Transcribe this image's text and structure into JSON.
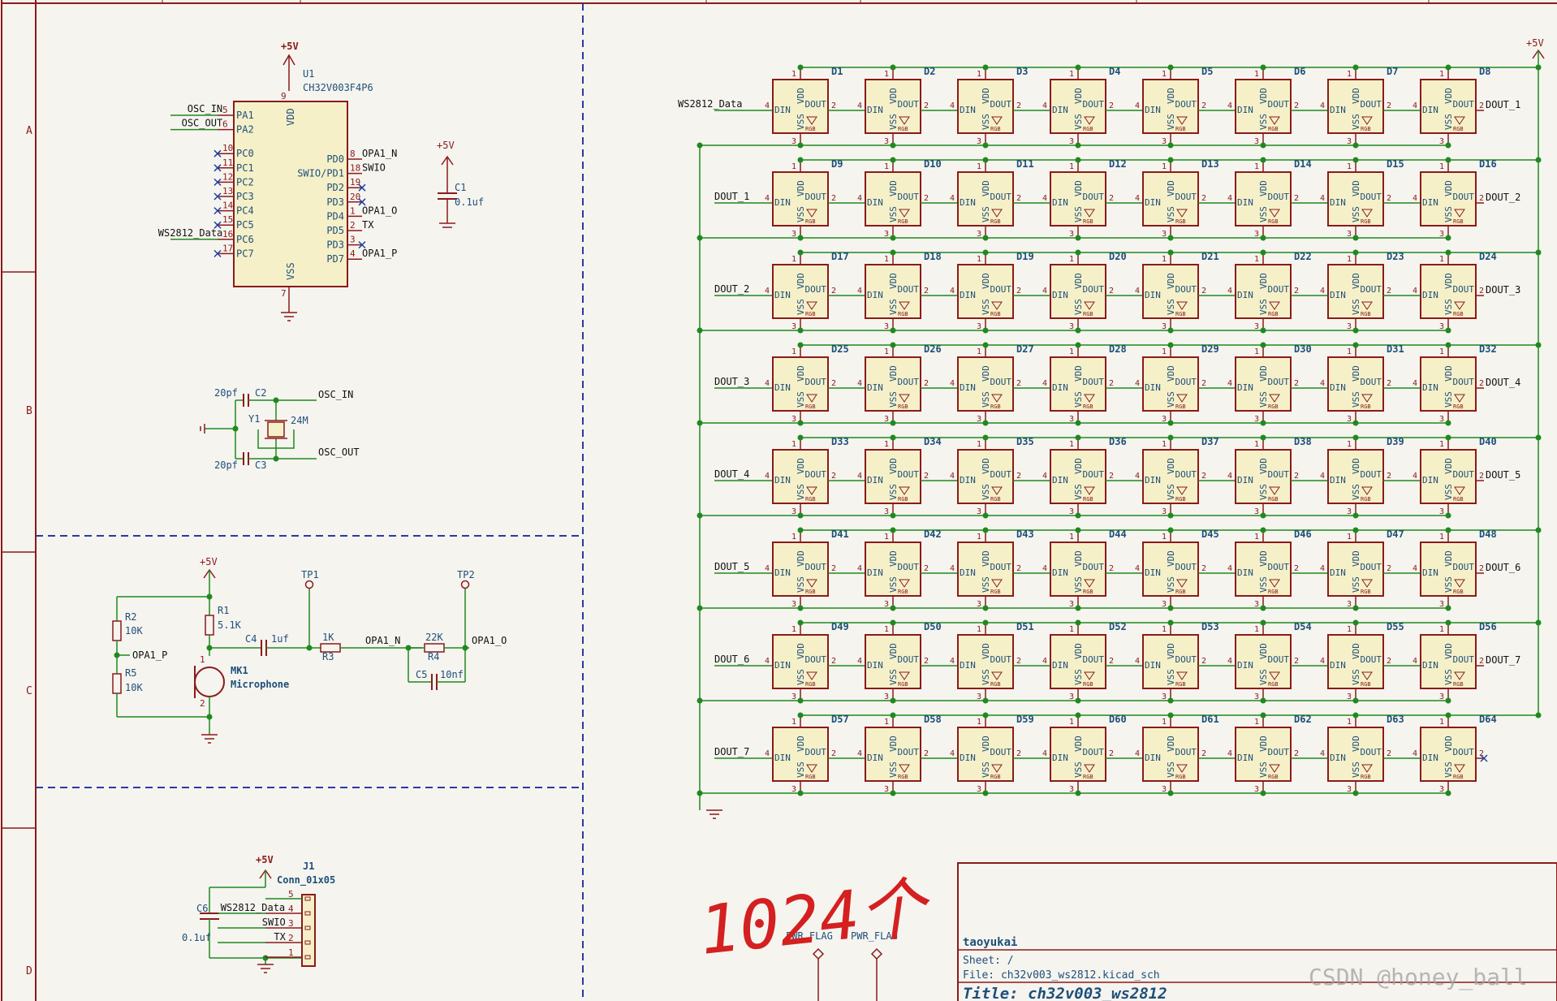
{
  "frame": {
    "row_labels": [
      "A",
      "B",
      "C",
      "D"
    ]
  },
  "mcu": {
    "ref": "U1",
    "value": "CH32V003F4P6",
    "power_label": "+5V",
    "vdd_label": "VDD",
    "vss_label": "VSS",
    "vdd_pin": "9",
    "vss_pin": "7",
    "left_pins": [
      {
        "num": "5",
        "name": "PA1",
        "net": "OSC_IN",
        "nc": false
      },
      {
        "num": "6",
        "name": "PA2",
        "net": "OSC_OUT",
        "nc": false
      },
      {
        "num": "10",
        "name": "PC0",
        "net": "",
        "nc": true
      },
      {
        "num": "11",
        "name": "PC1",
        "net": "",
        "nc": true
      },
      {
        "num": "12",
        "name": "PC2",
        "net": "",
        "nc": true
      },
      {
        "num": "13",
        "name": "PC3",
        "net": "",
        "nc": true
      },
      {
        "num": "14",
        "name": "PC4",
        "net": "",
        "nc": true
      },
      {
        "num": "15",
        "name": "PC5",
        "net": "",
        "nc": true
      },
      {
        "num": "16",
        "name": "PC6",
        "net": "WS2812_Data",
        "nc": false
      },
      {
        "num": "17",
        "name": "PC7",
        "net": "",
        "nc": true
      }
    ],
    "right_pins": [
      {
        "num": "8",
        "name": "PD0",
        "net": "OPA1_N",
        "nc": false
      },
      {
        "num": "18",
        "name": "SWIO/PD1",
        "net": "SWIO",
        "nc": false
      },
      {
        "num": "19",
        "name": "PD2",
        "net": "",
        "nc": true
      },
      {
        "num": "20",
        "name": "PD3",
        "net": "",
        "nc": true
      },
      {
        "num": "1",
        "name": "PD4",
        "net": "OPA1_O",
        "nc": false
      },
      {
        "num": "2",
        "name": "PD5",
        "net": "TX",
        "nc": false
      },
      {
        "num": "3",
        "name": "PD3",
        "net": "",
        "nc": true
      },
      {
        "num": "4",
        "name": "PD7",
        "net": "OPA1_P",
        "nc": false
      }
    ]
  },
  "c1": {
    "power": "+5V",
    "ref": "C1",
    "value": "0.1uf"
  },
  "crystal": {
    "c2_value": "20pf",
    "c2_ref": "C2",
    "c3_value": "20pf",
    "c3_ref": "C3",
    "y_ref": "Y1",
    "y_value": "24M",
    "net_in": "OSC_IN",
    "net_out": "OSC_OUT"
  },
  "mic": {
    "power": "+5V",
    "r2_ref": "R2",
    "r2_value": "10K",
    "r5_ref": "R5",
    "r5_value": "10K",
    "r1_ref": "R1",
    "r1_value": "5.1K",
    "net_p": "OPA1_P",
    "c4_ref": "C4",
    "c4_value": "1uf",
    "tp1": "TP1",
    "tp2": "TP2",
    "r3_value": "1K",
    "r3_ref": "R3",
    "net_n": "OPA1_N",
    "r4_value": "22K",
    "r4_ref": "R4",
    "net_o": "OPA1_O",
    "c5_ref": "C5",
    "c5_value": "10nf",
    "mk_ref": "MK1",
    "mk_value": "Microphone",
    "pin1": "1",
    "pin2": "2"
  },
  "conn": {
    "power": "+5V",
    "ref": "J1",
    "value": "Conn_01x05",
    "c6_ref": "C6",
    "c6_value": "0.1uf",
    "pins": [
      {
        "num": "5",
        "net": ""
      },
      {
        "num": "4",
        "net": "WS2812_Data"
      },
      {
        "num": "3",
        "net": "SWIO"
      },
      {
        "num": "2",
        "net": "TX"
      },
      {
        "num": "1",
        "net": ""
      }
    ]
  },
  "leds": {
    "power": "+5V",
    "rows": 8,
    "cols": 8,
    "din": "DIN",
    "dout": "DOUT",
    "vdd": "VDD",
    "vss": "VSS",
    "rgb": "RGB",
    "pin_vdd": "1",
    "pin_vss": "3",
    "pin_din": "4",
    "pin_dout": "2",
    "row_inputs": [
      "WS2812_Data",
      "DOUT_1",
      "DOUT_2",
      "DOUT_3",
      "DOUT_4",
      "DOUT_5",
      "DOUT_6",
      "DOUT_7"
    ],
    "row_outputs": [
      "DOUT_1",
      "DOUT_2",
      "DOUT_3",
      "DOUT_4",
      "DOUT_5",
      "DOUT_6",
      "DOUT_7",
      ""
    ],
    "ref_prefix": "D"
  },
  "pwr_flags": [
    "PWR_FLAG",
    "PWR_FLAG"
  ],
  "handwriting": "1024个",
  "title_block": {
    "company": "taoyukai",
    "sheet": "Sheet: /",
    "file": "File: ch32v003_ws2812.kicad_sch",
    "title": "Title: ch32v003_ws2812"
  },
  "watermark": "CSDN @honey_ball",
  "colors": {
    "background": "#f5f4ef",
    "wire": "#1f8a1f",
    "symbol": "#8b1a1a",
    "symbol_fill": "#f5f0c8",
    "label": "#1f4f7a",
    "sheet_border": "#8b1a1a",
    "dashed": "#2a3aa0",
    "handwriting": "#d42020",
    "junction": "#1f8a1f"
  }
}
